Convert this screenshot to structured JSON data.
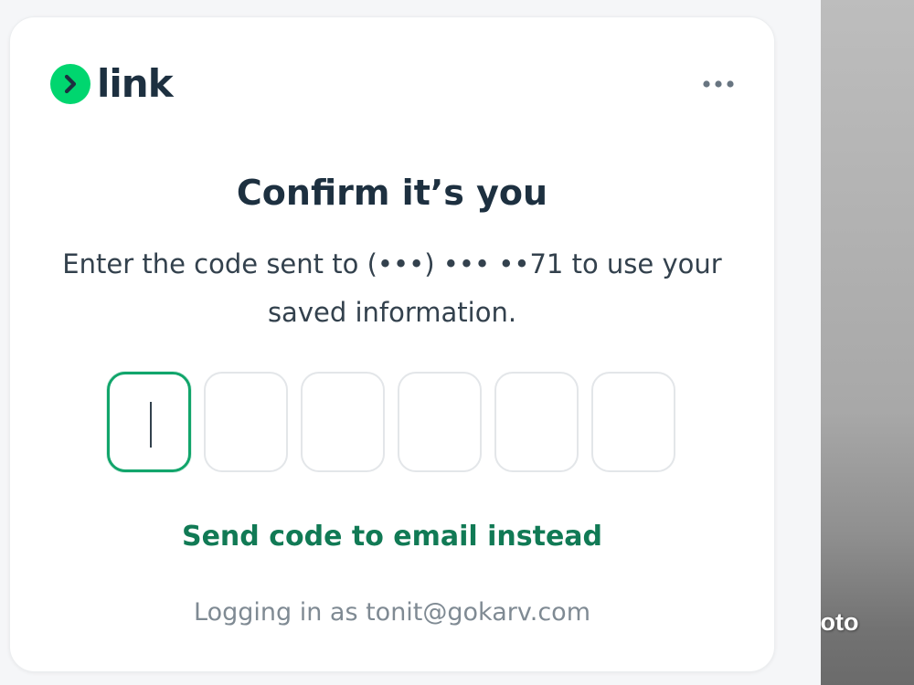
{
  "logo": {
    "text": "link",
    "brand_color": "#00D66F",
    "icon": "chevron-right-icon"
  },
  "menu": {
    "icon": "more-horizontal-icon"
  },
  "dialog": {
    "title": "Confirm it’s you",
    "subtitle": "Enter the code sent to (•••) ••• ••71 to use your saved information.",
    "otp": {
      "length": 6,
      "values": [
        "",
        "",
        "",
        "",
        "",
        ""
      ],
      "active_index": 0,
      "active_border_color": "#11A56B"
    },
    "email_link": "Send code to email instead",
    "footer": "Logging in as tonit@gokarv.com"
  },
  "side_panel": {
    "text": "loto"
  },
  "colors": {
    "accent": "#11A56B",
    "link": "#117A55",
    "heading": "#1D3040"
  }
}
